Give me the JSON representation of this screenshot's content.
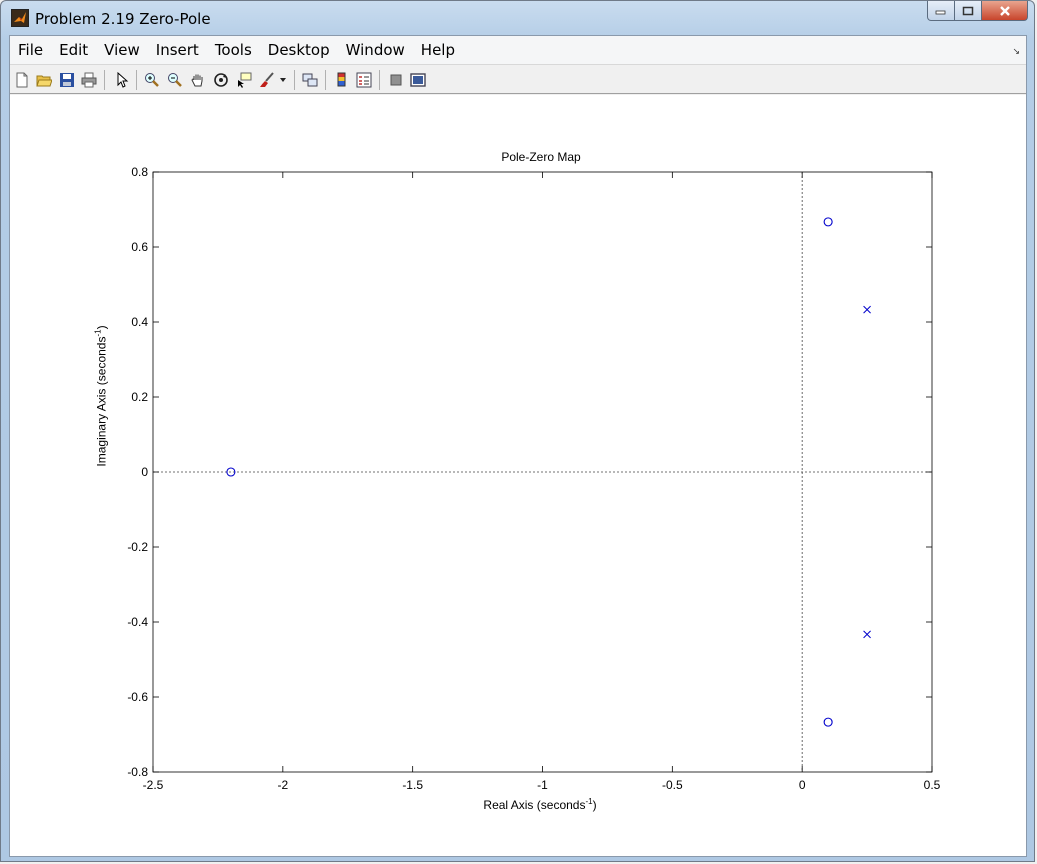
{
  "window": {
    "title": "Problem 2.19 Zero-Pole"
  },
  "menu": {
    "items": [
      "File",
      "Edit",
      "View",
      "Insert",
      "Tools",
      "Desktop",
      "Window",
      "Help"
    ]
  },
  "toolbar": {
    "icons": [
      "new-figure-icon",
      "open-file-icon",
      "save-icon",
      "print-icon",
      "edit-plot-pointer-icon",
      "zoom-in-icon",
      "zoom-out-icon",
      "pan-hand-icon",
      "rotate-3d-icon",
      "data-cursor-icon",
      "brush-icon",
      "link-plot-icon",
      "insert-colorbar-icon",
      "insert-legend-icon",
      "hide-plot-tools-icon",
      "show-plot-tools-icon"
    ]
  },
  "chart_data": {
    "type": "scatter",
    "title": "Pole-Zero Map",
    "xlabel_text": "Real Axis (seconds",
    "xlabel_sup": "-1",
    "xlabel_end": ")",
    "ylabel_text": "Imaginary Axis (seconds",
    "ylabel_sup": "-1",
    "ylabel_end": ")",
    "xlim": [
      -2.5,
      0.5
    ],
    "ylim": [
      -0.8,
      0.8
    ],
    "xticks": [
      "-2.5",
      "-2",
      "-1.5",
      "-1",
      "-0.5",
      "0",
      "0.5"
    ],
    "yticks": [
      "-0.8",
      "-0.6",
      "-0.4",
      "-0.2",
      "0",
      "0.2",
      "0.4",
      "0.6",
      "0.8"
    ],
    "xtick_values": [
      -2.5,
      -2,
      -1.5,
      -1,
      -0.5,
      0,
      0.5
    ],
    "ytick_values": [
      -0.8,
      -0.6,
      -0.4,
      -0.2,
      0,
      0.2,
      0.4,
      0.6,
      0.8
    ],
    "zeros": [
      {
        "x": -2.2,
        "y": 0
      },
      {
        "x": 0.1,
        "y": 0.667
      },
      {
        "x": 0.1,
        "y": -0.667
      }
    ],
    "poles": [
      {
        "x": 0.25,
        "y": 0.433
      },
      {
        "x": 0.25,
        "y": -0.433
      }
    ],
    "marker_color": "#0000cc",
    "grid": false
  }
}
